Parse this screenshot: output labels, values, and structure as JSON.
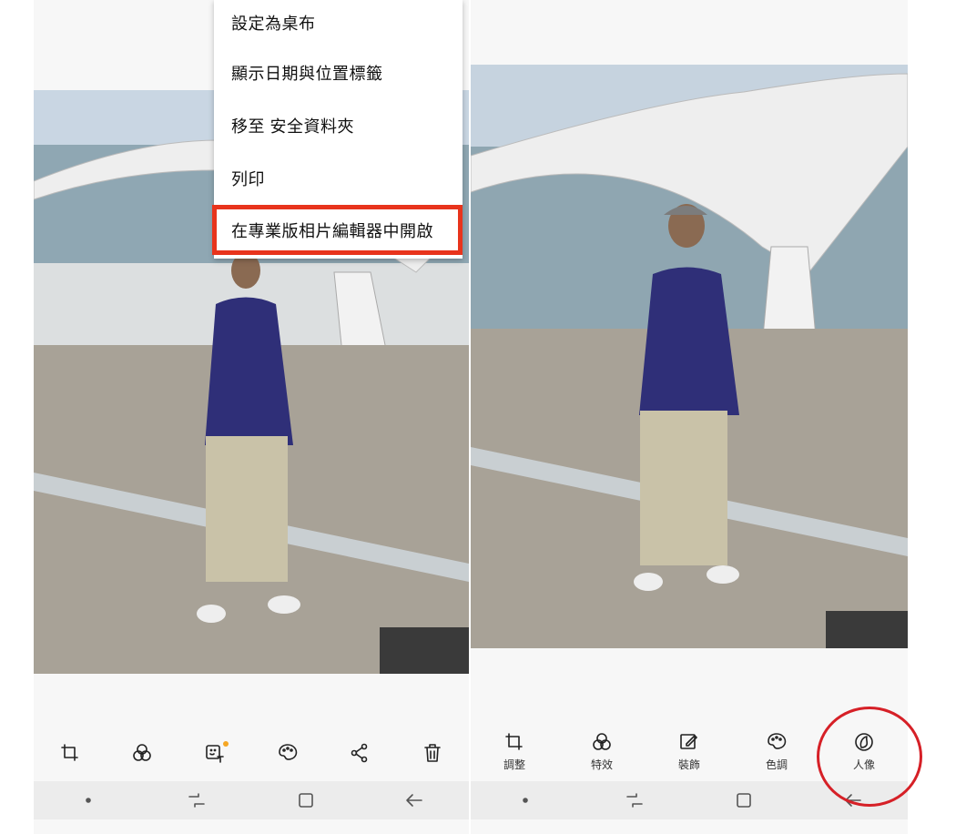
{
  "menu": {
    "items": [
      {
        "label": "設定為桌布"
      },
      {
        "label": "顯示日期與位置標籤"
      },
      {
        "label": "移至 安全資料夾"
      },
      {
        "label": "列印"
      },
      {
        "label": "在專業版相片編輯器中開啟"
      }
    ],
    "highlight_color": "#e8341c"
  },
  "left_toolbar": {
    "icons": [
      "crop-rotate-icon",
      "effects-icon",
      "sticker-text-icon",
      "color-palette-icon",
      "share-icon",
      "trash-icon"
    ],
    "notification_color": "#f5a623"
  },
  "right_toolbar": {
    "items": [
      {
        "label": "調整",
        "icon": "crop-rotate-icon"
      },
      {
        "label": "特效",
        "icon": "effects-icon"
      },
      {
        "label": "裝飾",
        "icon": "decorate-icon"
      },
      {
        "label": "色調",
        "icon": "color-palette-icon"
      },
      {
        "label": "人像",
        "icon": "portrait-icon"
      }
    ],
    "annotation_color": "#d62027"
  },
  "nav": {
    "icons": [
      "home-dot-icon",
      "recent-apps-icon",
      "home-icon",
      "back-icon"
    ]
  }
}
